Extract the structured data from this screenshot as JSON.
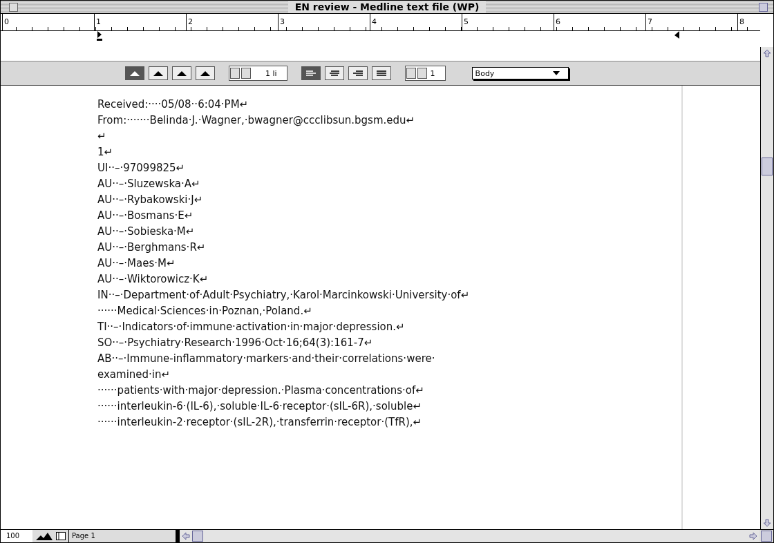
{
  "window": {
    "title": "EN review - Medline text file (WP)"
  },
  "ruler": {
    "marks": [
      "0",
      "1",
      "2",
      "3",
      "4",
      "5",
      "6",
      "7",
      "8"
    ]
  },
  "toolbar": {
    "spacing_buttons": [
      {
        "selected": true
      },
      {
        "selected": false
      },
      {
        "selected": false
      },
      {
        "selected": false
      }
    ],
    "line_spacing": "1 li",
    "align_buttons": [
      {
        "selected": true
      },
      {
        "selected": false
      },
      {
        "selected": false
      },
      {
        "selected": false
      }
    ],
    "columns": "1",
    "style": "Body"
  },
  "document": {
    "lines": [
      "Received:····05/08··6:04·PM↵",
      "From:·······Belinda·J.·Wagner,·bwagner@ccclibsun.bgsm.edu↵",
      "↵",
      "1↵",
      "UI··–·97099825↵",
      "AU··–·Sluzewska·A↵",
      "AU··–·Rybakowski·J↵",
      "AU··–·Bosmans·E↵",
      "AU··–·Sobieska·M↵",
      "AU··–·Berghmans·R↵",
      "AU··–·Maes·M↵",
      "AU··–·Wiktorowicz·K↵",
      "IN··–·Department·of·Adult·Psychiatry,·Karol·Marcinkowski·University·of↵",
      "······Medical·Sciences·in·Poznan,·Poland.↵",
      "TI··–·Indicators·of·immune·activation·in·major·depression.↵",
      "SO··–·Psychiatry·Research·1996·Oct·16;64(3):161-7↵",
      "AB··–·Immune-inflammatory·markers·and·their·correlations·were·",
      "examined·in↵",
      "······patients·with·major·depression.·Plasma·concentrations·of↵",
      "······interleukin-6·(IL-6),·soluble·IL-6·receptor·(sIL-6R),·soluble↵",
      "······interleukin-2·receptor·(sIL-2R),·transferrin·receptor·(TfR),↵"
    ]
  },
  "status_bar": {
    "zoom": "100",
    "page": "Page 1"
  }
}
